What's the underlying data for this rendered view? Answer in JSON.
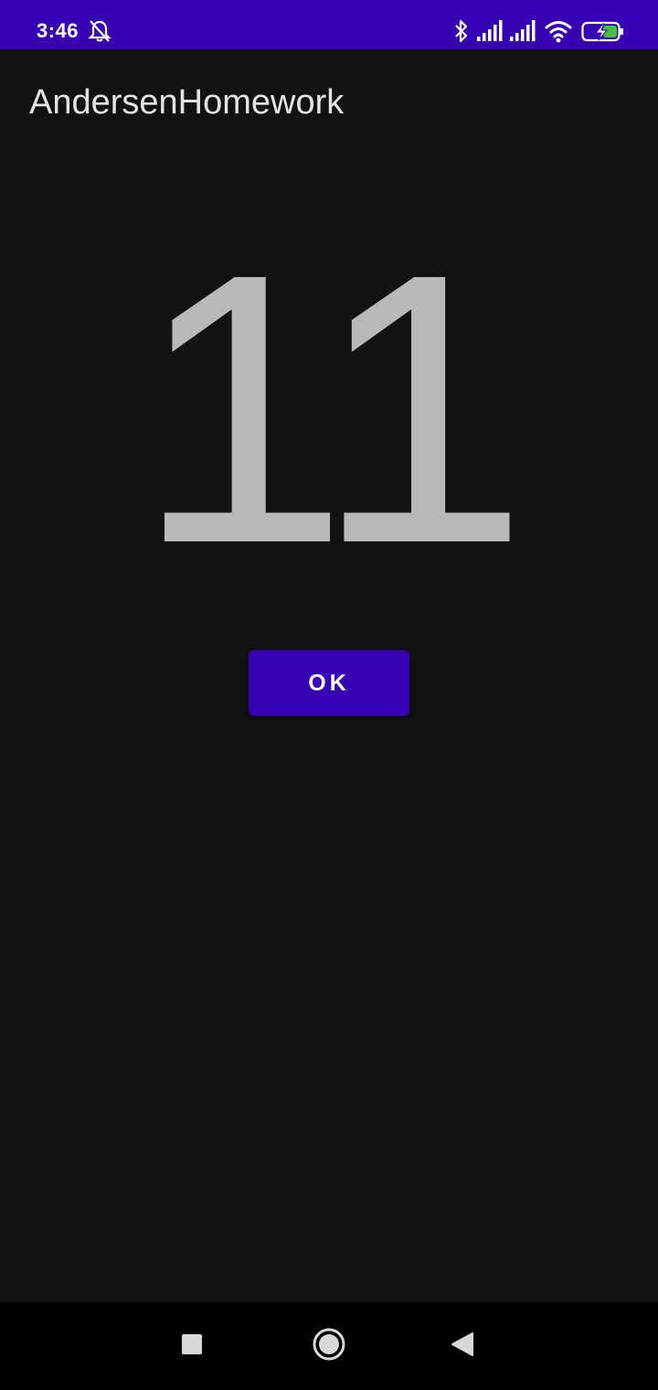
{
  "status_bar": {
    "time": "3:46",
    "color": "#3700b3",
    "icons": [
      "alarm-off-icon",
      "bluetooth-icon",
      "signal-icon",
      "signal-icon",
      "wifi-icon",
      "battery-charging-icon"
    ]
  },
  "app_bar": {
    "title": "AndersenHomework"
  },
  "main": {
    "counter": "11",
    "ok_button_label": "OK",
    "accent": "#3700b3",
    "battery_accent": "#44c23f"
  },
  "nav_bar": {
    "buttons": [
      "recents-square-icon",
      "home-circle-icon",
      "back-triangle-icon"
    ]
  }
}
